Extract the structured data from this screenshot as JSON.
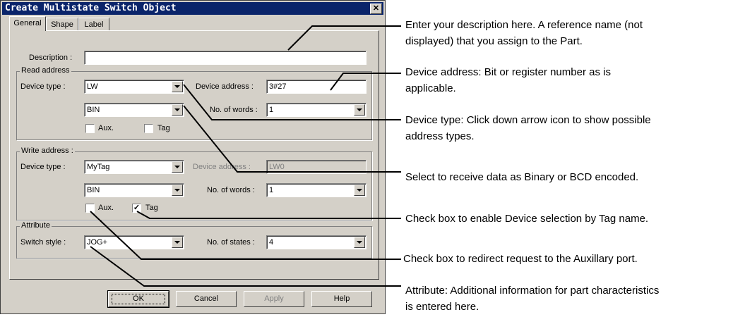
{
  "dialog": {
    "title": "Create Multistate Switch  Object",
    "close_glyph": "✕",
    "tabs": [
      {
        "label": "General"
      },
      {
        "label": "Shape"
      },
      {
        "label": "Label"
      }
    ],
    "description": {
      "label": "Description :",
      "value": ""
    },
    "read_address": {
      "group_title": "Read address",
      "device_type_label": "Device type :",
      "device_type_value": "LW",
      "device_address_label": "Device address :",
      "device_address_value": "3#27",
      "format_value": "BIN",
      "words_label": "No. of words :",
      "words_value": "1",
      "aux_label": "Aux.",
      "aux_checked": false,
      "tag_label": "Tag",
      "tag_checked": false
    },
    "write_address": {
      "group_title": "Write address :",
      "device_type_label": "Device type :",
      "device_type_value": "MyTag",
      "device_address_label": "Device address :",
      "device_address_value": "LW0",
      "format_value": "BIN",
      "words_label": "No. of words :",
      "words_value": "1",
      "aux_label": "Aux.",
      "aux_checked": false,
      "tag_label": "Tag",
      "tag_checked": true,
      "check_glyph": "✓"
    },
    "attribute": {
      "group_title": "Attribute",
      "switch_style_label": "Switch style :",
      "switch_style_value": "JOG+",
      "states_label": "No. of states :",
      "states_value": "4"
    },
    "buttons": {
      "ok": "OK",
      "cancel": "Cancel",
      "apply": "Apply",
      "help": "Help"
    }
  },
  "callouts": [
    {
      "line1": "Enter your description here. A reference name (not",
      "line2": "displayed) that you assign to the Part."
    },
    {
      "line1": "Device address: Bit or register number as is",
      "line2": "applicable."
    },
    {
      "line1": "Device type: Click down arrow icon to show possible",
      "line2": "address types."
    },
    {
      "line1": "Select to receive data as Binary or BCD encoded.",
      "line2": ""
    },
    {
      "line1": "Check box to enable Device selection by Tag name.",
      "line2": ""
    },
    {
      "line1": "Check box to redirect request to the Auxillary port.",
      "line2": ""
    },
    {
      "line1": "Attribute: Additional information for part characteristics",
      "line2": "is entered here."
    }
  ]
}
